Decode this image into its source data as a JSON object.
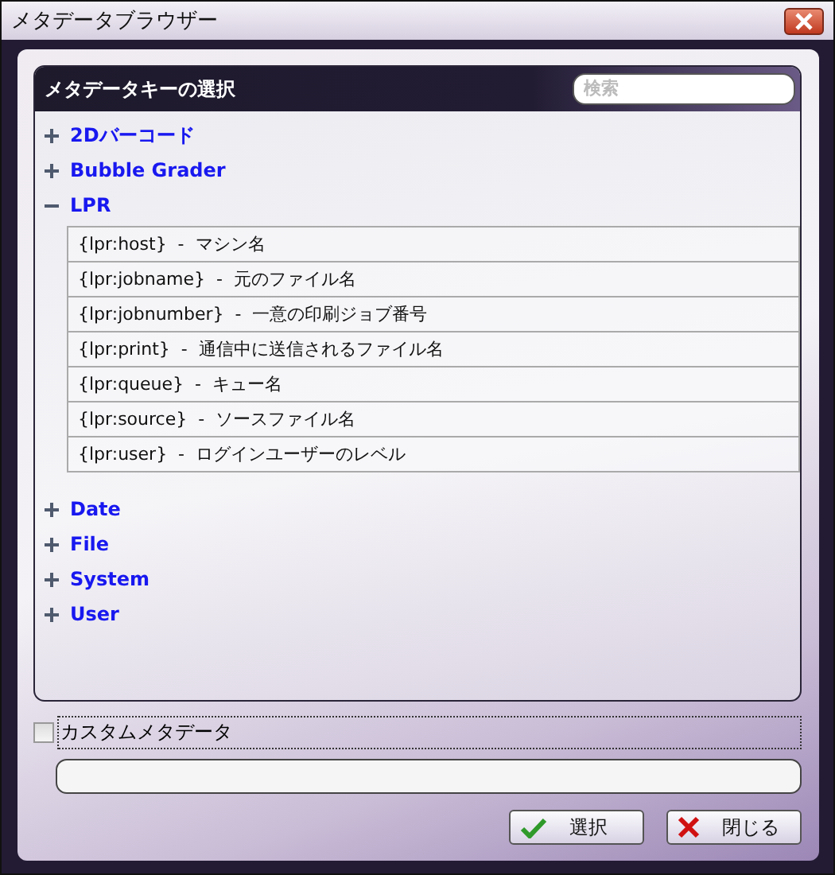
{
  "window": {
    "title": "メタデータブラウザー"
  },
  "panel": {
    "title": "メタデータキーの選択",
    "search": {
      "placeholder": "検索"
    }
  },
  "tree": [
    {
      "label": "2Dバーコード",
      "expanded": false
    },
    {
      "label": "Bubble Grader",
      "expanded": false
    },
    {
      "label": "LPR",
      "expanded": true,
      "children": [
        {
          "label": "{lpr:host}  -  マシン名"
        },
        {
          "label": "{lpr:jobname}  -  元のファイル名"
        },
        {
          "label": "{lpr:jobnumber}  -  一意の印刷ジョブ番号"
        },
        {
          "label": "{lpr:print}  -  通信中に送信されるファイル名"
        },
        {
          "label": "{lpr:queue}  -  キュー名"
        },
        {
          "label": "{lpr:source}  -  ソースファイル名"
        },
        {
          "label": "{lpr:user}  -  ログインユーザーのレベル"
        }
      ]
    },
    {
      "label": "Date",
      "expanded": false
    },
    {
      "label": "File",
      "expanded": false
    },
    {
      "label": "System",
      "expanded": false
    },
    {
      "label": "User",
      "expanded": false
    }
  ],
  "custom": {
    "label": "カスタムメタデータ",
    "checked": false
  },
  "buttons": [
    {
      "label": "選択",
      "kind": "ok"
    },
    {
      "label": "閉じる",
      "kind": "close"
    }
  ]
}
